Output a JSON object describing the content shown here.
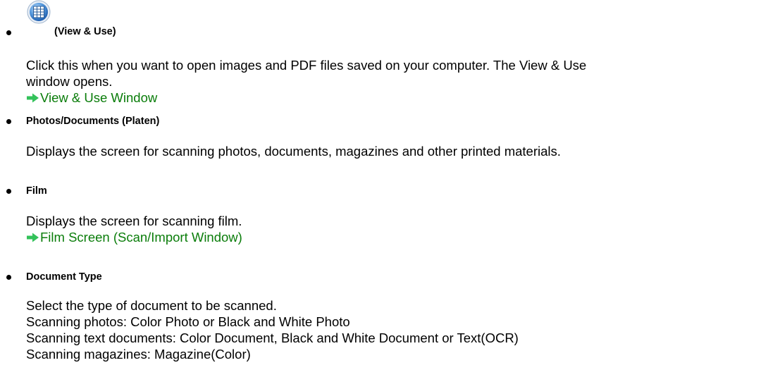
{
  "entries": [
    {
      "term": "(View & Use)",
      "icon": "view-and-use-icon",
      "description_lines": [
        "Click this when you want to open images and PDF files saved on your computer. The View & Use",
        "window opens."
      ],
      "link": "View & Use Window"
    },
    {
      "term": "Photos/Documents (Platen)",
      "description_lines": [
        "Displays the screen for scanning photos, documents, magazines and other printed materials."
      ]
    },
    {
      "term": "Film",
      "description_lines": [
        "Displays the screen for scanning film."
      ],
      "link": "Film Screen (Scan/Import Window)"
    },
    {
      "term": "Document Type",
      "description_lines": [
        "Select the type of document to be scanned.",
        "Scanning photos: Color Photo or Black and White Photo",
        "Scanning text documents: Color Document, Black and White Document or Text(OCR)",
        "Scanning magazines: Magazine(Color)"
      ]
    }
  ],
  "colors": {
    "link": "#0a7d0a",
    "arrow": "#33c25a",
    "text": "#000000"
  }
}
